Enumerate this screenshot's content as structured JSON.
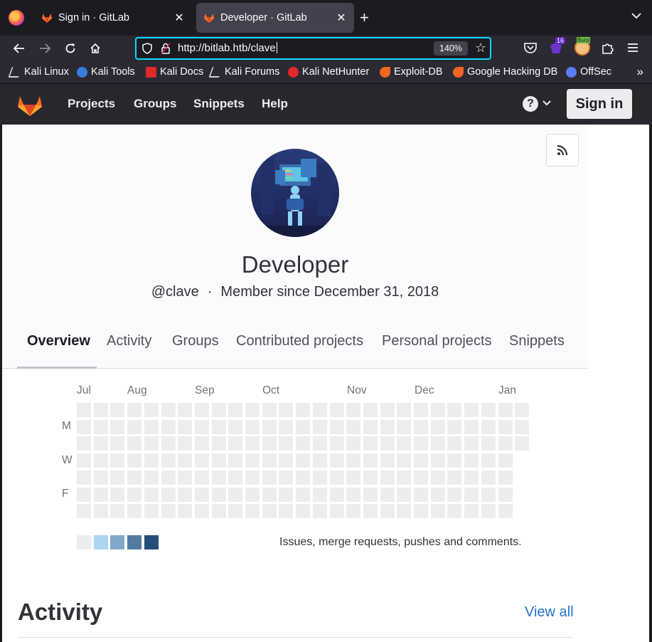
{
  "browser": {
    "tabs": [
      {
        "title": "Sign in · GitLab",
        "active": false
      },
      {
        "title": "Developer · GitLab",
        "active": true
      }
    ],
    "url": "http://bitlab.htb/clave",
    "zoom": "140%",
    "extension_badge": "16",
    "burp_label": "Burp",
    "bookmarks": [
      {
        "label": "Kali Linux",
        "icon": "kali-dragon-icon",
        "color": "#cfcfd8"
      },
      {
        "label": "Kali Tools",
        "icon": "kali-tools-icon",
        "color": "#3b7bdb"
      },
      {
        "label": "Kali Docs",
        "icon": "kali-docs-icon",
        "color": "#e02929"
      },
      {
        "label": "Kali Forums",
        "icon": "kali-forums-icon",
        "color": "#cfcfd8"
      },
      {
        "label": "Kali NetHunter",
        "icon": "nethunter-icon",
        "color": "#e02929"
      },
      {
        "label": "Exploit-DB",
        "icon": "exploit-db-icon",
        "color": "#f26522"
      },
      {
        "label": "Google Hacking DB",
        "icon": "ghdb-icon",
        "color": "#f26522"
      },
      {
        "label": "OffSec",
        "icon": "offsec-icon",
        "color": "#5c7cfa"
      }
    ]
  },
  "gitlab": {
    "nav": [
      "Projects",
      "Groups",
      "Snippets",
      "Help"
    ],
    "sign_in": "Sign in",
    "help_glyph": "?",
    "profile": {
      "name": "Developer",
      "username": "@clave",
      "member_since": "Member since December 31, 2018"
    },
    "tabs": [
      "Overview",
      "Activity",
      "Groups",
      "Contributed projects",
      "Personal projects",
      "Snippets"
    ],
    "active_tab": "Overview",
    "calendar": {
      "months": [
        "Jul",
        "Aug",
        "Sep",
        "Oct",
        "Nov",
        "Dec",
        "Jan"
      ],
      "days": [
        "M",
        "W",
        "F"
      ],
      "legend_colors": [
        "#ededed",
        "#acd5f2",
        "#7fa8c9",
        "#527ba0",
        "#254e77"
      ],
      "legend_text": "Issues, merge requests, pushes and comments."
    },
    "activity": {
      "title": "Activity",
      "view_all": "View all"
    }
  }
}
